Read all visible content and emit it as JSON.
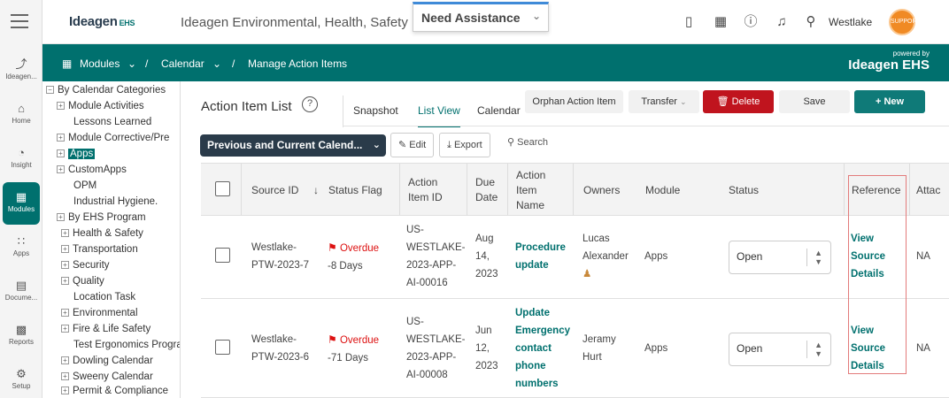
{
  "rail": {
    "items": [
      {
        "label": "Ideagen...",
        "icon": "ideagen-icon"
      },
      {
        "label": "Home",
        "icon": "home-icon"
      },
      {
        "label": "Insight",
        "icon": "chart-pie-icon"
      },
      {
        "label": "Modules",
        "icon": "modules-icon",
        "active": true
      },
      {
        "label": "Apps",
        "icon": "apps-icon"
      },
      {
        "label": "Docume...",
        "icon": "document-icon"
      },
      {
        "label": "Reports",
        "icon": "reports-icon"
      },
      {
        "label": "Setup",
        "icon": "gear-icon"
      }
    ]
  },
  "header": {
    "logo_main": "Ideagen",
    "logo_sub": "EHS",
    "app_title": "Ideagen Environmental, Health, Safety",
    "assistance": "Need Assistance",
    "user_name": "Westlake",
    "avatar_text": "SUPPORT"
  },
  "breadcrumb": {
    "modules": "Modules",
    "calendar": "Calendar",
    "current": "Manage Action Items",
    "sep": "/",
    "powered_by": "powered by",
    "powered_logo": "Ideagen EHS"
  },
  "tree": {
    "items": [
      {
        "label": "By Calendar Categories",
        "expand": true
      },
      {
        "label": "Module Activities",
        "expand": true
      },
      {
        "label": "Lessons Learned",
        "expand": false
      },
      {
        "label": "Module Corrective/Pre",
        "expand": true
      },
      {
        "label": "Apps",
        "expand": true,
        "selected": true
      },
      {
        "label": "CustomApps",
        "expand": true
      },
      {
        "label": "OPM",
        "expand": false
      },
      {
        "label": "Industrial Hygiene.",
        "expand": false
      },
      {
        "label": "By EHS Program",
        "expand": true
      },
      {
        "label": "Health & Safety",
        "expand": true
      },
      {
        "label": "Transportation",
        "expand": true
      },
      {
        "label": "Security",
        "expand": true
      },
      {
        "label": "Quality",
        "expand": true
      },
      {
        "label": "Location Task",
        "expand": false
      },
      {
        "label": "Environmental",
        "expand": true
      },
      {
        "label": "Fire & Life Safety",
        "expand": true
      },
      {
        "label": "Test Ergonomics Progra",
        "expand": false
      },
      {
        "label": "Dowling Calendar",
        "expand": true
      },
      {
        "label": "Sweeny Calendar",
        "expand": true
      },
      {
        "label": "Permit & Compliance",
        "expand": true
      }
    ]
  },
  "content": {
    "title": "Action Item List",
    "help": "?",
    "tabs": [
      "Snapshot",
      "List View",
      "Calendar"
    ],
    "active_tab": "List View",
    "buttons": {
      "orphan": "Orphan Action Item",
      "transfer": "Transfer",
      "delete": "Delete",
      "save": "Save",
      "new": "New"
    },
    "filter": "Previous and Current Calend...",
    "edit": "Edit",
    "export": "Export",
    "search": "Search"
  },
  "table": {
    "headers": {
      "source_id": "Source ID",
      "status_flag": "Status Flag",
      "action_item_id": "Action Item ID",
      "due_date": "Due Date",
      "action_item_name": "Action Item Name",
      "owners": "Owners",
      "module": "Module",
      "status": "Status",
      "reference": "Reference",
      "attac": "Attac"
    },
    "rows": [
      {
        "source_id": [
          "Westlake-",
          "PTW-2023-7"
        ],
        "flag_text": "Overdue",
        "days": "-8 Days",
        "action_item_id": [
          "US-",
          "WESTLAKE-",
          "2023-APP-",
          "AI-00016"
        ],
        "due_date": [
          "Aug",
          "14,",
          "2023"
        ],
        "name": [
          "Procedure",
          "update"
        ],
        "owners": [
          "Lucas",
          "Alexander"
        ],
        "module": "Apps",
        "status": "Open",
        "reference": [
          "View",
          "Source",
          "Details"
        ],
        "attac": "NA"
      },
      {
        "source_id": [
          "Westlake-",
          "PTW-2023-6"
        ],
        "flag_text": "Overdue",
        "days": "-71 Days",
        "action_item_id": [
          "US-",
          "WESTLAKE-",
          "2023-APP-",
          "AI-00008"
        ],
        "due_date": [
          "Jun",
          "12,",
          "2023"
        ],
        "name": [
          "Update",
          "Emergency",
          "contact",
          "phone",
          "numbers"
        ],
        "owners": [
          "Jeramy",
          "Hurt"
        ],
        "module": "Apps",
        "status": "Open",
        "reference": [
          "View",
          "Source",
          "Details"
        ],
        "attac": "NA"
      }
    ]
  }
}
